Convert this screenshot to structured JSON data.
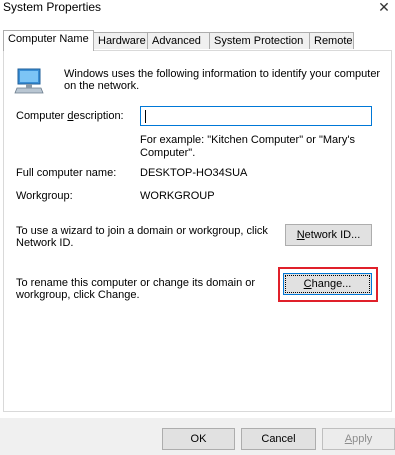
{
  "window": {
    "title": "System Properties",
    "close_glyph": "✕"
  },
  "tabs": [
    {
      "label": "Computer Name"
    },
    {
      "label": "Hardware"
    },
    {
      "label": "Advanced"
    },
    {
      "label": "System Protection"
    },
    {
      "label": "Remote"
    }
  ],
  "intro": {
    "line1": "Windows uses the following information to identify your computer",
    "line2": "on the network."
  },
  "description": {
    "label_pre": "Computer ",
    "label_u": "d",
    "label_post": "escription:",
    "value": "",
    "example_line1": "For example: \"Kitchen Computer\" or \"Mary's",
    "example_line2": "Computer\"."
  },
  "full_name": {
    "label": "Full computer name:",
    "value": "DESKTOP-HO34SUA"
  },
  "workgroup": {
    "label": "Workgroup:",
    "value": "WORKGROUP"
  },
  "network": {
    "text_line1": "To use a wizard to join a domain or workgroup, click",
    "text_line2": "Network ID.",
    "button_u": "N",
    "button_rest": "etwork ID..."
  },
  "rename": {
    "text_line1": "To rename this computer or change its domain or",
    "text_line2": "workgroup, click Change.",
    "button_u": "C",
    "button_rest": "hange..."
  },
  "footer": {
    "ok": "OK",
    "cancel": "Cancel",
    "apply_u": "A",
    "apply_rest": "pply"
  },
  "colors": {
    "highlight": "#e0202a",
    "focus": "#0078d7"
  }
}
